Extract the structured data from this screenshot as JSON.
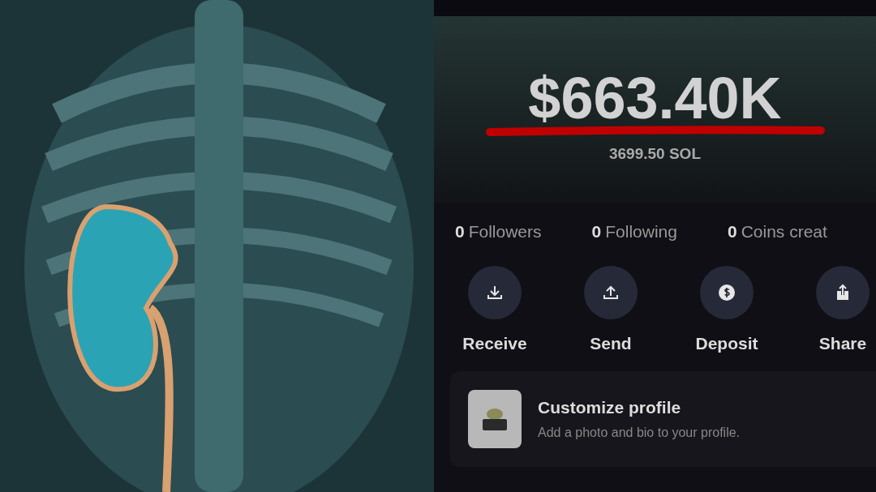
{
  "balance": {
    "amount": "$663.40K",
    "sol": "3699.50 SOL"
  },
  "stats": [
    {
      "count": "0",
      "label": "Followers"
    },
    {
      "count": "0",
      "label": "Following"
    },
    {
      "count": "0",
      "label": "Coins creat"
    }
  ],
  "actions": [
    {
      "kind": "receive",
      "label": "Receive"
    },
    {
      "kind": "send",
      "label": "Send"
    },
    {
      "kind": "deposit",
      "label": "Deposit"
    },
    {
      "kind": "share",
      "label": "Share"
    }
  ],
  "profile_card": {
    "title": "Customize profile",
    "subtitle": "Add a photo and bio to your profile."
  }
}
